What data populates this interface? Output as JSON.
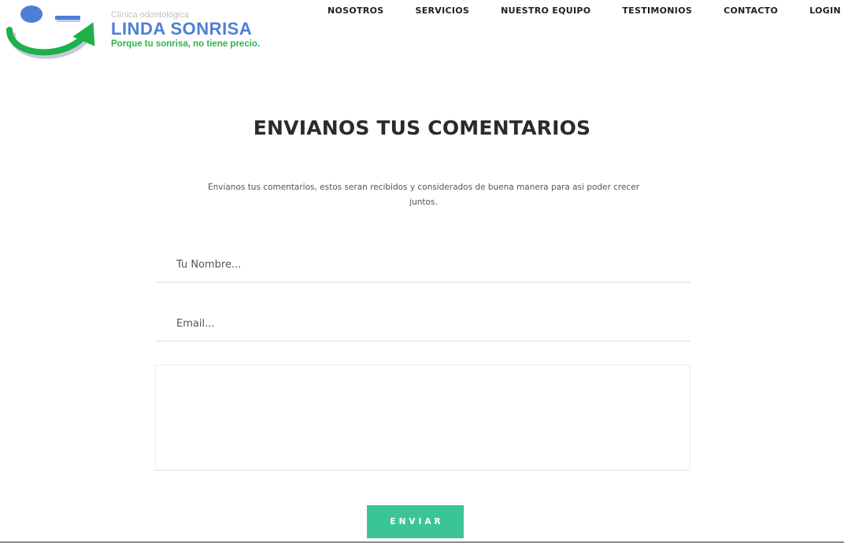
{
  "brand": {
    "small_text": "Clínica odontológica",
    "name": "LINDA SONRISA",
    "tagline": "Porque tu sonrisa, no tiene precio.",
    "colors": {
      "name": "#4f7ed6",
      "tagline": "#2fb24a",
      "arrow": "#1db14a",
      "dot": "#4f7ed6"
    }
  },
  "nav": {
    "items": [
      {
        "label": "NOSOTROS"
      },
      {
        "label": "SERVICIOS"
      },
      {
        "label": "NUESTRO EQUIPO"
      },
      {
        "label": "TESTIMONIOS"
      },
      {
        "label": "CONTACTO"
      },
      {
        "label": "LOGIN"
      }
    ]
  },
  "main": {
    "title": "ENVIANOS TUS COMENTARIOS",
    "subtitle": "Envianos tus comentarios, estos seran recibidos y considerados de buena manera para asi poder crecer juntos.",
    "form": {
      "name_placeholder": "Tu Nombre...",
      "name_value": "",
      "email_placeholder": "Email...",
      "email_value": "",
      "message_placeholder": "",
      "message_value": "",
      "submit_label": "ENVIAR",
      "submit_color": "#3cc594"
    }
  }
}
